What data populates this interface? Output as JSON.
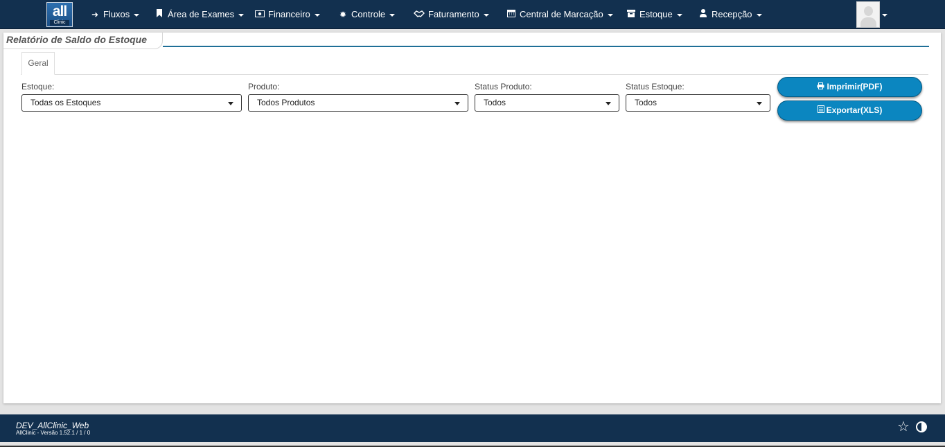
{
  "nav": {
    "logo_main": "all",
    "logo_sub": "Clinic",
    "items": [
      {
        "label": "Fluxos",
        "icon": "arrow-right-icon"
      },
      {
        "label": "Área de Exames",
        "icon": "bookmark-icon"
      },
      {
        "label": "Financeiro",
        "icon": "money-icon"
      },
      {
        "label": "Controle",
        "icon": "gear-icon"
      },
      {
        "label": "Faturamento",
        "icon": "handshake-icon"
      },
      {
        "label": "Central de Marcação",
        "icon": "calendar-icon"
      },
      {
        "label": "Estoque",
        "icon": "box-icon"
      },
      {
        "label": "Recepção",
        "icon": "user-icon"
      }
    ]
  },
  "page": {
    "title": "Relatório de Saldo do Estoque",
    "tab": "Geral"
  },
  "filters": {
    "estoque": {
      "label": "Estoque:",
      "value": "Todas os Estoques"
    },
    "produto": {
      "label": "Produto:",
      "value": "Todos Produtos"
    },
    "status_produto": {
      "label": "Status Produto:",
      "value": "Todos"
    },
    "status_estoque": {
      "label": "Status Estoque:",
      "value": "Todos"
    }
  },
  "actions": {
    "print_label": "Imprimir(PDF)",
    "export_label": "Exportar(XLS)"
  },
  "footer": {
    "env": "DEV_AllClinic_Web",
    "version": "AllClinic - Versão 1.52.1 / 1 / 0"
  },
  "colors": {
    "navbar": "#12304f",
    "accent": "#0b86c0",
    "title_line": "#1f6f97"
  }
}
